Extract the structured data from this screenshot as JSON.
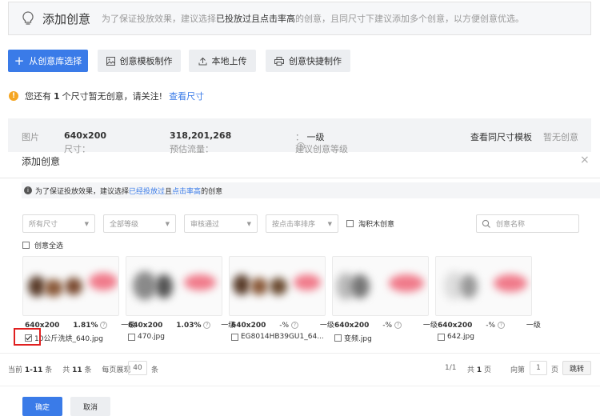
{
  "banner": {
    "title": "添加创意",
    "tip_prefix": "为了保证投放效果，建议选择",
    "tip_bold": "已投放过且点击率高",
    "tip_suffix": "的创意，且同尺寸下建议添加多个创意，以方便创意优选。"
  },
  "actions": {
    "from_library": "从创意库选择",
    "template": "创意模板制作",
    "upload": "本地上传",
    "quick": "创意快捷制作"
  },
  "warning": {
    "prefix": "您还有",
    "count": "1",
    "suffix": "个尺寸暂无创意，请关注!",
    "link": "查看尺寸"
  },
  "info_row": {
    "image_label": "图片",
    "size_label": "尺寸：",
    "size_value": "640x200",
    "traffic_label": "预估流量：",
    "traffic_value": "318,201,268",
    "level_label": "建议创意等级",
    "level_value": "一级",
    "same_size_link": "查看同尺寸模板",
    "no_creative": "暂无创意"
  },
  "modal": {
    "title": "添加创意",
    "close": "×",
    "notice_prefix": "为了保证投放效果，建议选择",
    "notice_link1": "已经投放过",
    "notice_mid": "且",
    "notice_link2": "点击率高",
    "notice_suffix": "的创意",
    "filters": {
      "size": "所有尺寸",
      "level": "全部等级",
      "review": "审核通过",
      "sort": "按点击率排序",
      "taojimu": "淘积木创意",
      "search_placeholder": "创意名称"
    },
    "select_all": "创意全选",
    "cards": [
      {
        "size": "640x200",
        "ctr": "1.81%",
        "level": "一级",
        "name": "10公斤洗烘_640.jpg",
        "checked": true
      },
      {
        "size": "640x200",
        "ctr": "1.03%",
        "level": "一级",
        "name": "470.jpg",
        "checked": false
      },
      {
        "size": "640x200",
        "ctr": "-%",
        "level": "一级",
        "name": "EG8014HB39GU1_64...",
        "checked": false
      },
      {
        "size": "640x200",
        "ctr": "-%",
        "level": "一级",
        "name": "变频.jpg",
        "checked": false
      },
      {
        "size": "640x200",
        "ctr": "-%",
        "level": "一级",
        "name": "642.jpg",
        "checked": false
      }
    ],
    "pagination": {
      "current_prefix": "当前",
      "current_range": "1-11",
      "current_unit": "条",
      "total_prefix": "共",
      "total": "11",
      "total_unit": "条",
      "per_page_label": "每页展现",
      "per_page": "40",
      "per_page_unit": "条",
      "page_info": "1/1",
      "pages_prefix": "共",
      "pages": "1",
      "pages_unit": "页",
      "goto_label": "向第",
      "goto_value": "1",
      "goto_unit": "页",
      "jump": "跳转"
    },
    "confirm": "确定",
    "cancel": "取消"
  },
  "colors": {
    "primary": "#3a7be8",
    "warning": "#f5a623",
    "highlight": "#e02020"
  }
}
